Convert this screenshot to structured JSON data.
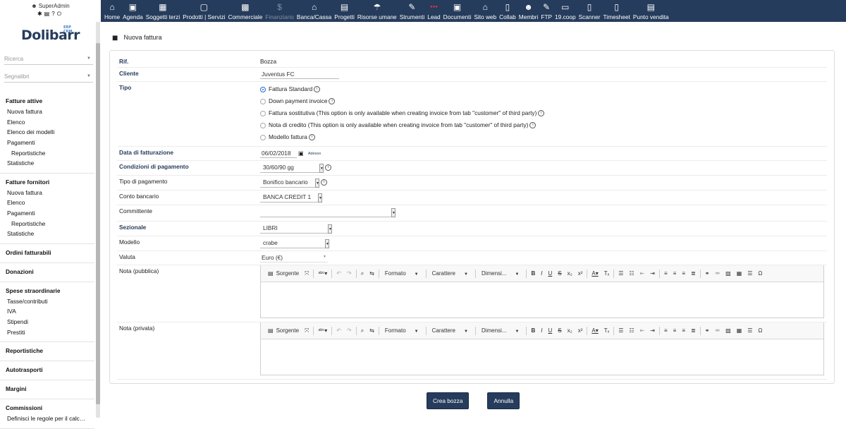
{
  "header": {
    "user_name": "SuperAdmin",
    "menus": [
      {
        "label": "Home",
        "icon": "house-icon",
        "glyph": "⌂",
        "enabled": true
      },
      {
        "label": "Agenda",
        "icon": "calendar-icon",
        "glyph": "▣",
        "enabled": true
      },
      {
        "label": "Soggetti terzi",
        "icon": "building-icon",
        "glyph": "▦",
        "enabled": true
      },
      {
        "label": "Prodotti | Servizi",
        "icon": "cube-icon",
        "glyph": "▢",
        "enabled": true
      },
      {
        "label": "Commerciale",
        "icon": "briefcase-icon",
        "glyph": "▩",
        "enabled": true
      },
      {
        "label": "Finanziario",
        "icon": "dollar-icon",
        "glyph": "$",
        "enabled": false
      },
      {
        "label": "Banca/Cassa",
        "icon": "bank-icon",
        "glyph": "⌂",
        "enabled": true
      },
      {
        "label": "Progetti",
        "icon": "clipboard-icon",
        "glyph": "▤",
        "enabled": true
      },
      {
        "label": "Risorse umane",
        "icon": "umbrella-icon",
        "glyph": "☂",
        "enabled": true
      },
      {
        "label": "Strumenti",
        "icon": "wrench-icon",
        "glyph": "✎",
        "enabled": true
      },
      {
        "label": "Lead",
        "icon": "lead-icon",
        "glyph": "●●●",
        "enabled": true
      },
      {
        "label": "Documenti",
        "icon": "documents-icon",
        "glyph": "▣",
        "enabled": true
      },
      {
        "label": "Sito web",
        "icon": "globe-house-icon",
        "glyph": "⌂",
        "enabled": true
      },
      {
        "label": "Collab",
        "icon": "file-icon",
        "glyph": "▯",
        "enabled": true
      },
      {
        "label": "Membri",
        "icon": "users-icon",
        "glyph": "☻",
        "enabled": true
      },
      {
        "label": "FTP",
        "icon": "wrench-icon",
        "glyph": "✎",
        "enabled": true
      },
      {
        "label": "19.coop",
        "icon": "window-icon",
        "glyph": "▭",
        "enabled": true
      },
      {
        "label": "Scanner",
        "icon": "file-icon",
        "glyph": "▯",
        "enabled": true
      },
      {
        "label": "Timesheet",
        "icon": "file-icon",
        "glyph": "▯",
        "enabled": true
      },
      {
        "label": "Punto vendita",
        "icon": "printer-icon",
        "glyph": "▤",
        "enabled": true
      }
    ]
  },
  "sidebar": {
    "logo": "Dolibarr",
    "logo_sub": "ERP CRM",
    "search_placeholder": "Ricerca",
    "bookmarks_placeholder": "Segnalibri",
    "groups": [
      {
        "title": "Fatture attive",
        "items": [
          {
            "label": "Nuova fattura",
            "sub": false
          },
          {
            "label": "Elenco",
            "sub": false
          },
          {
            "label": "Elenco dei modelli",
            "sub": false
          },
          {
            "label": "Pagamenti",
            "sub": false
          },
          {
            "label": "Reportistiche",
            "sub": true
          },
          {
            "label": "Statistiche",
            "sub": false
          }
        ]
      },
      {
        "title": "Fatture fornitori",
        "items": [
          {
            "label": "Nuova fattura",
            "sub": false
          },
          {
            "label": "Elenco",
            "sub": false
          },
          {
            "label": "Pagamenti",
            "sub": false
          },
          {
            "label": "Reportistiche",
            "sub": true
          },
          {
            "label": "Statistiche",
            "sub": false
          }
        ]
      },
      {
        "title": "Ordini fatturabili",
        "items": []
      },
      {
        "title": "Donazioni",
        "items": []
      },
      {
        "title": "Spese straordinarie",
        "items": [
          {
            "label": "Tasse/contributi",
            "sub": false
          },
          {
            "label": "IVA",
            "sub": false
          },
          {
            "label": "Stipendi",
            "sub": false
          },
          {
            "label": "Prestiti",
            "sub": false
          }
        ]
      },
      {
        "title": "Reportistiche",
        "items": []
      },
      {
        "title": "Autotrasporti",
        "items": []
      },
      {
        "title": "Margini",
        "items": []
      },
      {
        "title": "Commissioni",
        "items": [
          {
            "label": "Definisci le regole per il calcolo ...",
            "sub": false
          }
        ]
      }
    ]
  },
  "page": {
    "title": "Nuova fattura"
  },
  "form": {
    "ref_label": "Rif.",
    "ref_value": "Bozza",
    "cliente_label": "Cliente",
    "cliente_value": "Juventus FC",
    "tipo_label": "Tipo",
    "tipo_options": [
      {
        "label": "Fattura Standard",
        "selected": true
      },
      {
        "label": "Down payment invoice",
        "selected": false
      },
      {
        "label": "Fattura sostitutiva (This option is only available when creating invoice from tab \"customer\" of third party)",
        "selected": false
      },
      {
        "label": "Nota di credito (This option is only available when creating invoice from tab \"customer\" of third party)",
        "selected": false
      },
      {
        "label": "Modello fattura",
        "selected": false
      }
    ],
    "data_label": "Data di fatturazione",
    "data_value": "06/02/2018",
    "data_now": "Adesso",
    "condizioni_label": "Condizioni di pagamento",
    "condizioni_value": "30/60/90 gg",
    "tipo_pagamento_label": "Tipo di pagamento",
    "tipo_pagamento_value": "Bonifico bancario",
    "conto_label": "Conto bancario",
    "conto_value": "BANCA CREDIT 1",
    "committente_label": "Committente",
    "committente_value": "",
    "sezionale_label": "Sezionale",
    "sezionale_value": "LIBRI",
    "modello_label": "Modello",
    "modello_value": "crabe",
    "valuta_label": "Valuta",
    "valuta_value": "Euro (€)",
    "nota_pubblica_label": "Nota (pubblica)",
    "nota_privata_label": "Nota (privata)"
  },
  "editor_toolbar": {
    "source": "Sorgente",
    "format": "Formato",
    "font": "Carattere",
    "size": "Dimensi..."
  },
  "buttons": {
    "create": "Crea bozza",
    "cancel": "Annulla"
  }
}
